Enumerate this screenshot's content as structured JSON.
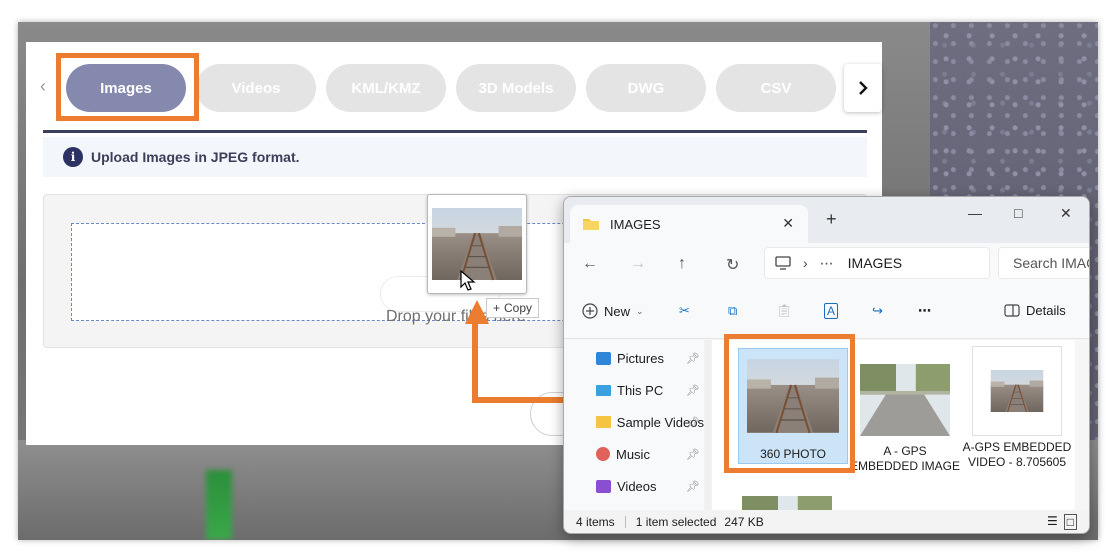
{
  "web": {
    "tabs": [
      {
        "label": "Images",
        "active": true
      },
      {
        "label": "Videos"
      },
      {
        "label": "KML/KMZ"
      },
      {
        "label": "3D Models"
      },
      {
        "label": "DWG"
      },
      {
        "label": "CSV"
      }
    ],
    "info_text": "Upload Images in JPEG format.",
    "drop_text": "Drop your files here",
    "drag_copy_label": "Copy"
  },
  "explorer": {
    "tab_title": "IMAGES",
    "breadcrumb_current": "IMAGES",
    "search_placeholder": "Search IMAGES",
    "toolbar": {
      "new_label": "New",
      "details_label": "Details"
    },
    "sidebar": [
      {
        "label": "Pictures"
      },
      {
        "label": "This PC"
      },
      {
        "label": "Sample Videos"
      },
      {
        "label": "Music"
      },
      {
        "label": "Videos"
      }
    ],
    "files": [
      {
        "name": "360 PHOTO",
        "selected": true
      },
      {
        "name": "A - GPS EMBEDDED IMAGE"
      },
      {
        "name": "A-GPS EMBEDDED VIDEO - 8.705605"
      }
    ],
    "status": {
      "items": "4 items",
      "selection": "1 item selected",
      "size": "247 KB"
    }
  },
  "colors": {
    "highlight": "#ec7c30",
    "tab_active": "#8589ad",
    "tab_inactive": "#e4e4e4",
    "info_icon": "#2c3262"
  }
}
